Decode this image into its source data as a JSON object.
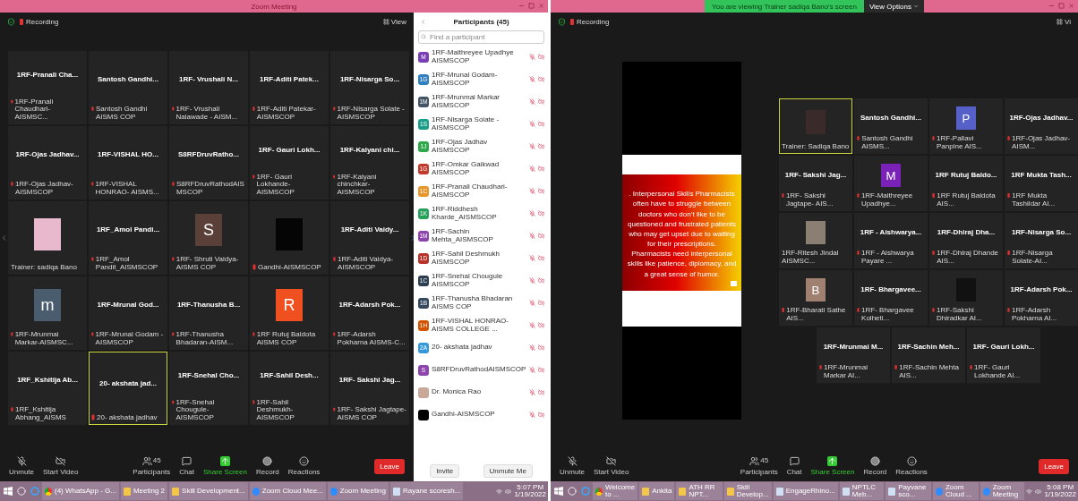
{
  "windows": [
    {
      "title": "Zoom Meeting",
      "recording": "Recording",
      "view_label": "View",
      "kind": "gallery",
      "tiles": [
        {
          "kind": "name",
          "name": "1RF-Pranali Cha...",
          "caption": "1RF-Pranali Chaudhari- AISMSC...",
          "muted": true,
          "highlighted": false
        },
        {
          "kind": "name",
          "name": "Santosh Gandhi...",
          "caption": "Santosh Gandhi AISMS COP",
          "muted": true,
          "highlighted": false
        },
        {
          "kind": "name",
          "name": "1RF- Vrushali N...",
          "caption": "1RF- Vrushali Nalawade - AISM...",
          "muted": true,
          "highlighted": false
        },
        {
          "kind": "name",
          "name": "1RF-Aditi Patek...",
          "caption": "1RF-Aditi Patekar-AISMSCOP",
          "muted": true,
          "highlighted": false
        },
        {
          "kind": "name",
          "name": "1RF-Nisarga So...",
          "caption": "1RF-Nisarga Solate - AISMSCOP",
          "muted": true,
          "highlighted": false
        },
        {
          "kind": "name",
          "name": "1RF-Ojas Jadhav...",
          "caption": "1RF-Ojas Jadhav-AISMSCOP",
          "muted": true,
          "highlighted": false
        },
        {
          "kind": "name",
          "name": "1RF-VISHAL HO...",
          "caption": "1RF-VISHAL HONRAO- AISMS...",
          "muted": true,
          "highlighted": false
        },
        {
          "kind": "name",
          "name": "S8RFDruvRatho...",
          "caption": "S8RFDruvRathodAISMSCOP",
          "muted": true,
          "highlighted": false
        },
        {
          "kind": "name",
          "name": "1RF- Gauri Lokh...",
          "caption": "1RF- Gauri Lokhande-AISMSCOP",
          "muted": true,
          "highlighted": false
        },
        {
          "kind": "name",
          "name": "1RF-Kalyani chi...",
          "caption": "1RF-Kalyani chinchkar-AISMSCOP",
          "muted": true,
          "highlighted": false
        },
        {
          "kind": "photo",
          "color": "#e8b8cc",
          "caption": "Trainer: sadiqa Bano",
          "muted": false,
          "highlighted": false
        },
        {
          "kind": "name",
          "name": "1RF_Amol Pandi...",
          "caption": "1RF_Amol Pandit_AISMSCOP",
          "muted": true,
          "highlighted": false
        },
        {
          "kind": "avatar",
          "letter": "S",
          "color": "#5a4038",
          "caption": "1RF- Shruti Vaidya-AISMS COP",
          "muted": true,
          "highlighted": false
        },
        {
          "kind": "photo",
          "color": "#050505",
          "caption": "Gandhi-AISMSCOP",
          "muted": true,
          "highlighted": false
        },
        {
          "kind": "name",
          "name": "1RF-Aditi Vaidy...",
          "caption": "1RF-Aditi Vaidya-AISMSCOP",
          "muted": true,
          "highlighted": false
        },
        {
          "kind": "avatar",
          "letter": "m",
          "color": "#4a5d6e",
          "caption": "1RF-Mrunmai Markar-AISMSC...",
          "muted": true,
          "highlighted": false
        },
        {
          "kind": "name",
          "name": "1RF-Mrunal God...",
          "caption": "1RF-Mrunal Godam - AISMSCOP",
          "muted": true,
          "highlighted": false
        },
        {
          "kind": "name",
          "name": "1RF-Thanusha B...",
          "caption": "1RF-Thanusha Bhadaran-AISM...",
          "muted": true,
          "highlighted": false
        },
        {
          "kind": "avatar",
          "letter": "R",
          "color": "#f05020",
          "caption": "1RF Rutuj Baldota AISMS COP",
          "muted": true,
          "highlighted": false
        },
        {
          "kind": "name",
          "name": "1RF-Adarsh Pok...",
          "caption": "1RF-Adarsh Pokharna AISMS-C...",
          "muted": true,
          "highlighted": false
        },
        {
          "kind": "name",
          "name": "1RF_Kshitija Ab...",
          "caption": "1RF_Kshitija Abhang_AISMS",
          "muted": true,
          "highlighted": false
        },
        {
          "kind": "name",
          "name": "20- akshata jad...",
          "caption": "20- akshata jadhav",
          "muted": true,
          "highlighted": true
        },
        {
          "kind": "name",
          "name": "1RF-Snehal Cho...",
          "caption": "1RF-Snehal Chougule-AISMSCOP",
          "muted": true,
          "highlighted": false
        },
        {
          "kind": "name",
          "name": "1RF-Sahil Desh...",
          "caption": "1RF-Sahil Deshmukh-AISMSCOP",
          "muted": true,
          "highlighted": false
        },
        {
          "kind": "name",
          "name": "1RF- Sakshi Jag...",
          "caption": "1RF- Sakshi Jagtape- AISMS COP",
          "muted": true,
          "highlighted": false
        }
      ],
      "toolbar": [
        {
          "kind": "mic",
          "label": "Unmute"
        },
        {
          "kind": "video",
          "label": "Start Video"
        },
        {
          "kind": "participants",
          "label": "Participants",
          "count": "45"
        },
        {
          "kind": "chat",
          "label": "Chat"
        },
        {
          "kind": "share",
          "label": "Share Screen"
        },
        {
          "kind": "record",
          "label": "Record"
        },
        {
          "kind": "reactions",
          "label": "Reactions"
        }
      ],
      "leave": "Leave",
      "participants_panel": {
        "title": "Participants (45)",
        "search_placeholder": "Find a participant",
        "people": [
          {
            "kind": "initials",
            "initials": "M",
            "color": "#7b3fb5",
            "name": "1RF-Maithreyee Upadhye AISMSCOP"
          },
          {
            "kind": "initials",
            "initials": "1G",
            "color": "#2f7fc1",
            "name": "1RF-Mrunal Godam- AISMSCOP"
          },
          {
            "kind": "initials",
            "initials": "1M",
            "color": "#445566",
            "name": "1RF-Mrunmai Markar AISMSCOP"
          },
          {
            "kind": "initials",
            "initials": "1S",
            "color": "#1a9e8a",
            "name": "1RF-Nisarga Solate - AISMSCOP"
          },
          {
            "kind": "initials",
            "initials": "1J",
            "color": "#2ea84a",
            "name": "1RF-Ojas Jadhav AISMSCOP"
          },
          {
            "kind": "initials",
            "initials": "1G",
            "color": "#c0392b",
            "name": "1RF-Omkar Gaikwad AISMSCOP"
          },
          {
            "kind": "initials",
            "initials": "1C",
            "color": "#e8962a",
            "name": "1RF-Pranali Chaudhari- AISMSCOP"
          },
          {
            "kind": "initials",
            "initials": "1K",
            "color": "#27a05a",
            "name": "1RF-Riddhesh Kharde_AISMSCOP"
          },
          {
            "kind": "initials",
            "initials": "1M",
            "color": "#8e44ad",
            "name": "1RF-Sachin Mehta_AISMSCOP"
          },
          {
            "kind": "initials",
            "initials": "1D",
            "color": "#b83227",
            "name": "1RF-Sahil Deshmukh AISMSCOP"
          },
          {
            "kind": "initials",
            "initials": "1C",
            "color": "#2c3e50",
            "name": "1RF-Snehal Chougule AISMSCOP"
          },
          {
            "kind": "initials",
            "initials": "1B",
            "color": "#34495e",
            "name": "1RF-Thanusha Bhadaran AISMS COP"
          },
          {
            "kind": "initials",
            "initials": "1H",
            "color": "#d35400",
            "name": "1RF-VISHAL HONRAO- AISMS COLLEGE ..."
          },
          {
            "kind": "initials",
            "initials": "2A",
            "color": "#3498db",
            "name": "20- akshata jadhav"
          },
          {
            "kind": "initials",
            "initials": "S",
            "color": "#8e44ad",
            "name": "S8RFDruvRathodAISMSCOP"
          },
          {
            "kind": "photo",
            "color": "#c9a89a",
            "name": "Dr. Monica Rao"
          },
          {
            "kind": "photo",
            "color": "#000000",
            "name": "Gandhi-AISMSCOP"
          }
        ],
        "buttons": [
          "Invite",
          "Unmute Me"
        ]
      },
      "taskbar": [
        {
          "kind": "chrome",
          "label": "(4) WhatsApp - G..."
        },
        {
          "kind": "folder",
          "label": "Meeting 2"
        },
        {
          "kind": "folder",
          "label": "Skill Development..."
        },
        {
          "kind": "zoom",
          "label": "Zoom Cloud Mee..."
        },
        {
          "kind": "zoom",
          "label": "Zoom Meeting"
        },
        {
          "kind": "doc",
          "label": "Rayane scoresh..."
        }
      ],
      "clock": {
        "time": "5:07 PM",
        "date": "1/19/2022"
      }
    },
    {
      "banner": "You are viewing Trainer sadiqa Bano's screen",
      "view_options": "View Options",
      "recording": "Recording",
      "view_label": "Vi",
      "kind": "share",
      "slide": {
        "text": ". Interpersonal Skills Pharmacists often have to struggle between doctors who don’t like to be questioned and frustrated patients who may get upset due to waiting for their prescriptions. Pharmacists need interpersonal skills like patience, diplomacy, and a great sense of humor."
      },
      "tiles": [
        {
          "kind": "photo",
          "color": "#3a2a2a",
          "caption": "Trainer: Sadiqa Bano",
          "muted": false,
          "highlighted": true
        },
        {
          "kind": "name",
          "name": "Santosh Gandhi...",
          "caption": "Santosh Gandhi AISMS...",
          "muted": true,
          "highlighted": false
        },
        {
          "kind": "avatar",
          "letter": "P",
          "color": "#5560c8",
          "caption": "1RF-Pallavi Panpine AIS...",
          "muted": true,
          "highlighted": false
        },
        {
          "kind": "name",
          "name": "1RF-Ojas Jadhav...",
          "caption": "1RF-Ojas Jadhav-AISM...",
          "muted": true,
          "highlighted": false
        },
        {
          "kind": "name",
          "name": "1RF- Sakshi Jag...",
          "caption": "1RF- Sakshi Jagtape- AIS...",
          "muted": true,
          "highlighted": false
        },
        {
          "kind": "avatar",
          "letter": "M",
          "color": "#7a22b8",
          "caption": "1RF-Maithreyee Upadhye...",
          "muted": true,
          "highlighted": false
        },
        {
          "kind": "name",
          "name": "1RF Rutuj Baldo...",
          "caption": "1RF Rutuj Baldota AIS...",
          "muted": true,
          "highlighted": false
        },
        {
          "kind": "name",
          "name": "1RF Mukta Tash...",
          "caption": "1RF Mukta Tashildar AI...",
          "muted": true,
          "highlighted": false
        },
        {
          "kind": "photo",
          "color": "#8a7f72",
          "caption": "1RF-Ritesh Jindal AISMSC...",
          "muted": false,
          "highlighted": false
        },
        {
          "kind": "name",
          "name": "1RF - Aishwarya...",
          "caption": "1RF - Aishwarya Payare ...",
          "muted": true,
          "highlighted": false
        },
        {
          "kind": "name",
          "name": "1RF-Dhiraj Dha...",
          "caption": "1RF-Dhiraj Dhande AIS...",
          "muted": true,
          "highlighted": false
        },
        {
          "kind": "name",
          "name": "1RF-Nisarga So...",
          "caption": "1RF-Nisarga Solate-AI...",
          "muted": true,
          "highlighted": false
        },
        {
          "kind": "avatar",
          "letter": "B",
          "color": "#a08070",
          "caption": "1RF-Bharati Sathe AIS...",
          "muted": true,
          "highlighted": false
        },
        {
          "kind": "name",
          "name": "1RF- Bhargavee...",
          "caption": "1RF- Bhargavee Kolheti...",
          "muted": true,
          "highlighted": false
        },
        {
          "kind": "photo",
          "color": "#111111",
          "caption": "1RF-Sakshi Dhiradkar AI...",
          "muted": true,
          "highlighted": false
        },
        {
          "kind": "name",
          "name": "1RF-Adarsh Pok...",
          "caption": "1RF-Adarsh Pokharna AI...",
          "muted": true,
          "highlighted": false
        },
        {
          "kind": "name",
          "name": "1RF-Mrunmai M...",
          "caption": "1RF-Mrunmai Markar AI...",
          "muted": true,
          "highlighted": false
        },
        {
          "kind": "name",
          "name": "1RF-Sachin Meh...",
          "caption": "1RF-Sachin Mehta AIS...",
          "muted": true,
          "highlighted": false
        },
        {
          "kind": "name",
          "name": "1RF- Gauri Lokh...",
          "caption": "1RF- Gauri Lokhande AI...",
          "muted": true,
          "highlighted": false
        }
      ],
      "toolbar": [
        {
          "kind": "mic",
          "label": "Unmute"
        },
        {
          "kind": "video",
          "label": "Start Video"
        },
        {
          "kind": "participants",
          "label": "Participants",
          "count": "45"
        },
        {
          "kind": "chat",
          "label": "Chat"
        },
        {
          "kind": "share",
          "label": "Share Screen"
        },
        {
          "kind": "record",
          "label": "Record"
        },
        {
          "kind": "reactions",
          "label": "Reactions"
        }
      ],
      "leave": "Leave",
      "taskbar": [
        {
          "kind": "chrome",
          "label": "Welcome to ..."
        },
        {
          "kind": "folder",
          "label": "Ankita"
        },
        {
          "kind": "folder",
          "label": "ATH RR NPT..."
        },
        {
          "kind": "folder",
          "label": "Skill Develop..."
        },
        {
          "kind": "doc",
          "label": "EngageRhino..."
        },
        {
          "kind": "doc",
          "label": "NPTLC Meb..."
        },
        {
          "kind": "doc",
          "label": "Payvane sco..."
        },
        {
          "kind": "zoom",
          "label": "Zoom Cloud ..."
        },
        {
          "kind": "zoom",
          "label": "Zoom Meeting"
        }
      ],
      "clock": {
        "time": "5:08 PM",
        "date": "1/19/2022"
      }
    }
  ]
}
